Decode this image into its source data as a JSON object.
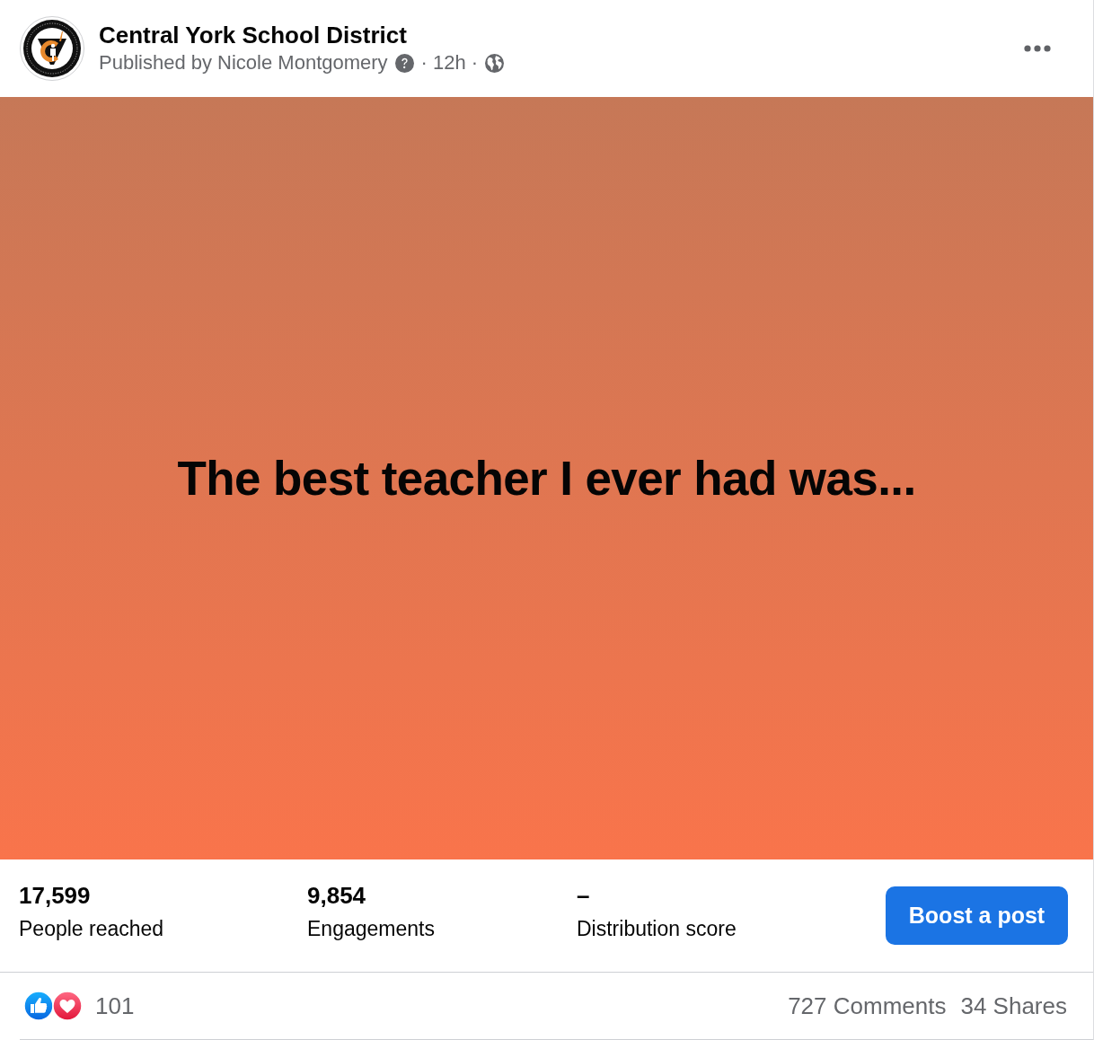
{
  "header": {
    "page_name": "Central York School District",
    "byline": "Published by Nicole Montgomery",
    "time": "· 12h ·"
  },
  "post": {
    "text": "The best teacher I ever had was..."
  },
  "insights": {
    "stats": [
      {
        "value": "17,599",
        "label": "People reached"
      },
      {
        "value": "9,854",
        "label": "Engagements"
      },
      {
        "value": "–",
        "label": "Distribution score"
      }
    ],
    "button": "Boost a post"
  },
  "engagement": {
    "reactions": [
      {
        "kind": "like"
      },
      {
        "kind": "love"
      }
    ],
    "reaction_count": "101",
    "comments": "727 Comments",
    "shares": "34 Shares"
  }
}
